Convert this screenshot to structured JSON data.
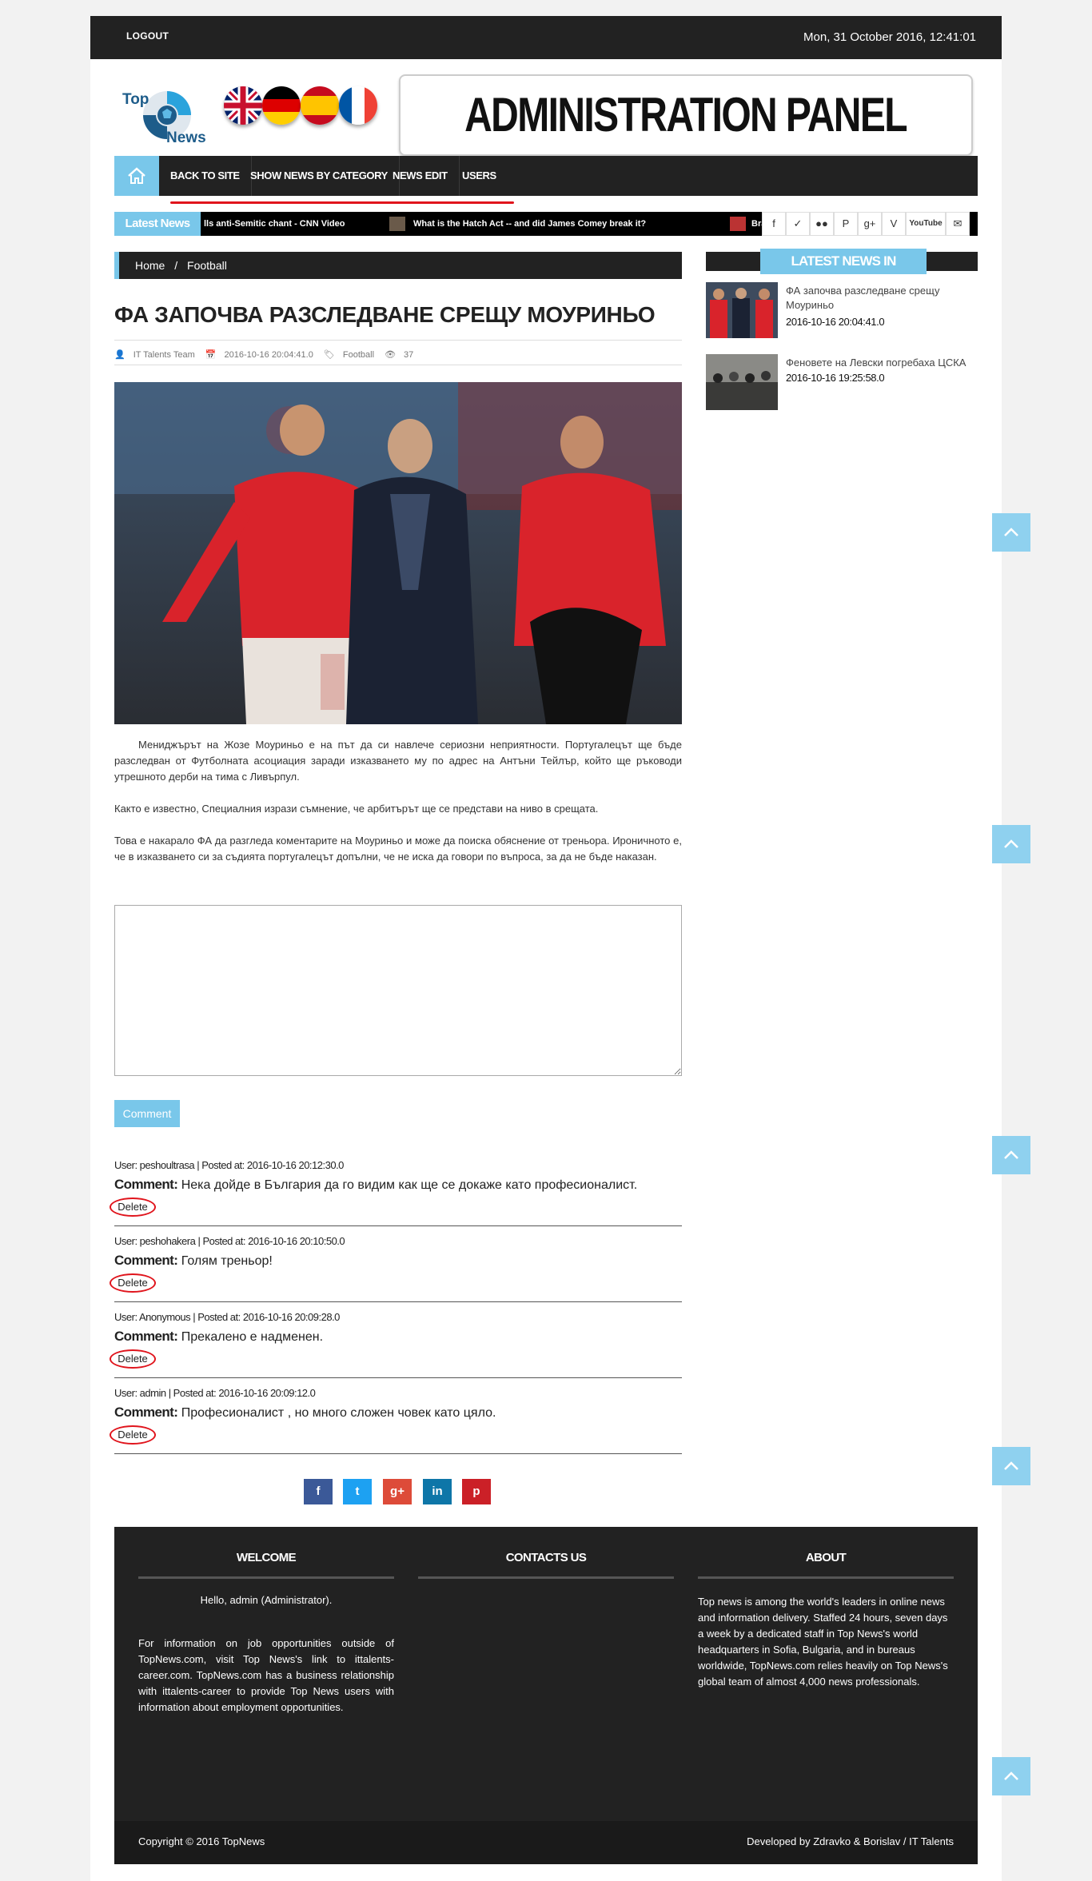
{
  "topbar": {
    "logout": "LOGOUT",
    "datetime": "Mon, 31 October 2016, 12:41:01"
  },
  "logo": {
    "line1": "Top",
    "line2": "News"
  },
  "flags": [
    "uk-flag",
    "germany-flag",
    "spain-flag",
    "france-flag"
  ],
  "panel_title": "ADMINISTRATION PANEL",
  "nav": {
    "items": [
      "BACK TO SITE",
      "SHOW NEWS BY CATEGORY",
      "NEWS EDIT",
      "USERS"
    ]
  },
  "ticker": {
    "label": "Latest News",
    "item1": "lls anti-Semitic chant - CNN Video",
    "item2": "What is the Hatch Act -- and did James Comey break it?",
    "item3": "Bracin"
  },
  "social_icons": [
    "facebook-icon",
    "twitter-icon",
    "flickr-icon",
    "pinterest-icon",
    "google-plus-icon",
    "vimeo-icon",
    "youtube-icon",
    "email-icon"
  ],
  "youtube_label": "YouTube",
  "breadcrumb": {
    "home": "Home",
    "sep": "/",
    "current": "Football"
  },
  "article": {
    "title": "ФА ЗАПОЧВА РАЗСЛЕДВАНЕ СРЕЩУ МОУРИНЬО",
    "author": "IT Talents Team",
    "date": "2016-10-16 20:04:41.0",
    "category": "Football",
    "views": "37",
    "p1": "Мениджърът на Жозе Моуриньо е на път да си навлече сериозни неприятности. Португалецът ще бъде разследван от Футболната асоциация заради изказването му по адрес на Антъни Тейлър, който ще ръководи утрешното дерби на тима с Ливърпул.",
    "p2": "Както е известно, Специалния изрази съмнение, че арбитърът ще се представи на ниво в срещата.",
    "p3": "Това е накарало ФА да разгледа коментарите на Моуриньо и може да поиска обяснение от треньора. Ироничното е, че в изказването си за съдията португалецът допълни, че не иска да говори по въпроса, за да не бъде наказан."
  },
  "comment_button": "Comment",
  "comments": [
    {
      "meta": "User: peshoultrasa | Posted at: 2016-10-16 20:12:30.0",
      "label": "Comment:",
      "text": "Нека дойде в България да го видим как ще се докаже като професионалист.",
      "delete": "Delete"
    },
    {
      "meta": "User: peshohakera | Posted at: 2016-10-16 20:10:50.0",
      "label": "Comment:",
      "text": "Голям треньор!",
      "delete": "Delete"
    },
    {
      "meta": "User: Anonymous | Posted at: 2016-10-16 20:09:28.0",
      "label": "Comment:",
      "text": "Прекалено е надменен.",
      "delete": "Delete"
    },
    {
      "meta": "User: admin | Posted at: 2016-10-16 20:09:12.0",
      "label": "Comment:",
      "text": "Професионалист , но много сложен човек като цяло.",
      "delete": "Delete"
    }
  ],
  "share": [
    {
      "icon": "facebook-icon",
      "glyph": "f",
      "color": "#3b5998"
    },
    {
      "icon": "twitter-icon",
      "glyph": "t",
      "color": "#1da1f2"
    },
    {
      "icon": "google-plus-icon",
      "glyph": "g+",
      "color": "#dd4b39"
    },
    {
      "icon": "linkedin-icon",
      "glyph": "in",
      "color": "#0e76a8"
    },
    {
      "icon": "pinterest-icon",
      "glyph": "p",
      "color": "#cb2027"
    }
  ],
  "sidebar": {
    "heading": "LATEST NEWS IN FOOTBALL",
    "items": [
      {
        "title": "ФА започва разследване срещу Моуриньо",
        "date": "2016-10-16 20:04:41.0"
      },
      {
        "title": "Феновете на Левски погребаха ЦСКА",
        "date": "2016-10-16 19:25:58.0"
      }
    ]
  },
  "footer": {
    "welcome": {
      "heading": "WELCOME",
      "greeting": "Hello, admin (Administrator).",
      "text": "For information on job opportunities outside of TopNews.com, visit Top News's link to ittalents-career.com. TopNews.com has a business relationship with ittalents-career to provide Top News users with information about employment opportunities."
    },
    "contacts": {
      "heading": "CONTACTS US"
    },
    "about": {
      "heading": "ABOUT",
      "text": "Top news is among the world's leaders in online news and information delivery. Staffed 24 hours, seven days a week by a dedicated staff in Top News's world headquarters in Sofia, Bulgaria, and in bureaus worldwide, TopNews.com relies heavily on Top News's global team of almost 4,000 news professionals."
    },
    "copyright": "Copyright © 2016 TopNews",
    "developed": "Developed by Zdravko & Borislav / IT Talents"
  },
  "colors": {
    "accent": "#79c7ea",
    "dark": "#222222",
    "highlight": "#e0141c"
  }
}
